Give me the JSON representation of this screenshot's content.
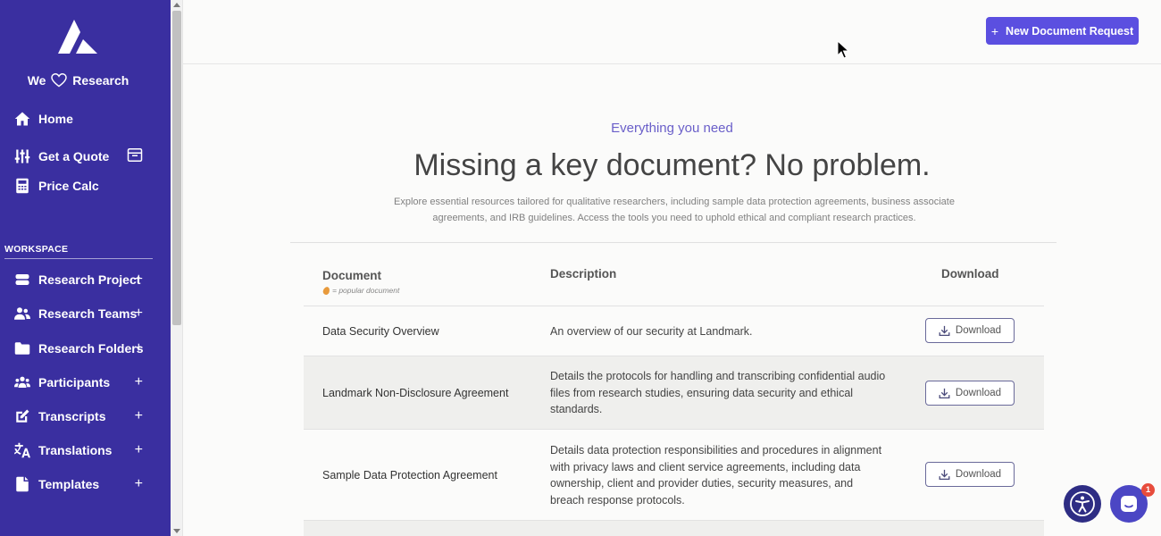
{
  "sidebar": {
    "tagline_left": "We",
    "tagline_right": "Research",
    "top_items": [
      {
        "label": "Home",
        "icon": "home-icon"
      },
      {
        "label": "Get a Quote",
        "icon": "sliders-icon"
      },
      {
        "label": "Price Calc",
        "icon": "calculator-icon"
      }
    ],
    "workspace_label": "WORKSPACE",
    "workspace_items": [
      {
        "label": "Research Project",
        "plus": "+",
        "icon": "database-icon"
      },
      {
        "label": "Research Teams",
        "plus": "+",
        "icon": "users-icon"
      },
      {
        "label": "Research Folders",
        "plus": "+",
        "icon": "folder-icon"
      },
      {
        "label": "Participants",
        "plus": "+",
        "icon": "people-group-icon"
      },
      {
        "label": "Transcripts",
        "plus": "+",
        "icon": "edit-icon"
      },
      {
        "label": "Translations",
        "plus": "+",
        "icon": "translate-icon"
      },
      {
        "label": "Templates",
        "plus": "+",
        "icon": "file-icon"
      }
    ]
  },
  "header": {
    "new_doc_plus": "+",
    "new_doc_label": "New Document Request"
  },
  "hero": {
    "eyebrow": "Everything you need",
    "title": "Missing a key document? No problem.",
    "description": "Explore essential resources tailored for qualitative researchers, including sample data protection agreements, business associate agreements, and IRB guidelines. Access the tools you need to uphold ethical and compliant research practices."
  },
  "table": {
    "col_document": "Document",
    "col_description": "Description",
    "col_download": "Download",
    "popular_note": "= popular document",
    "rows": [
      {
        "name": "Data Security Overview",
        "description": "An overview of our security at Landmark.",
        "button": "Download"
      },
      {
        "name": "Landmark Non-Disclosure Agreement",
        "description": "Details the protocols for handling and transcribing confidential audio files from research studies, ensuring data security and ethical standards.",
        "button": "Download"
      },
      {
        "name": "Sample Data Protection Agreement",
        "description": "Details data protection responsibilities and procedures in alignment with privacy laws and client service agreements, including data ownership, client and provider duties, security measures, and breach response protocols.",
        "button": "Download"
      }
    ]
  },
  "chat_badge": "1",
  "colors": {
    "sidebar": "#3a2fa0",
    "accent": "#5b4fe0"
  }
}
